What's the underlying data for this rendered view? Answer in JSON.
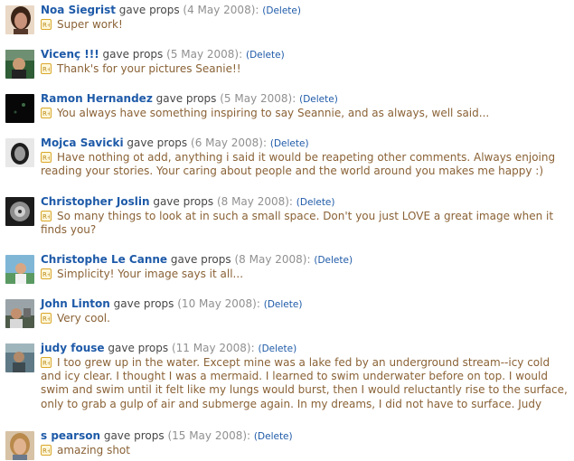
{
  "props": [
    {
      "user": "Noa Siegrist",
      "action": "gave props",
      "date": "(4 May 2008):",
      "delete_label": "(Delete)",
      "message": "Super work!"
    },
    {
      "user": "Vicenç !!!",
      "action": "gave props",
      "date": "(5 May 2008):",
      "delete_label": "(Delete)",
      "message": "Thank's for your pictures Seanie!!"
    },
    {
      "user": "Ramon Hernandez",
      "action": "gave props",
      "date": "(5 May 2008):",
      "delete_label": "(Delete)",
      "message": "You always have something inspiring to say Seannie, and as always, well said..."
    },
    {
      "user": "Mojca Savicki",
      "action": "gave props",
      "date": "(6 May 2008):",
      "delete_label": "(Delete)",
      "message": "Have nothing ot add, anything i said it would be reapeting other comments. Always enjoing reading your stories. Your caring about people and the world around you makes me happy :)"
    },
    {
      "user": "Christopher Joslin",
      "action": "gave props",
      "date": "(8 May 2008):",
      "delete_label": "(Delete)",
      "message": "So many things to look at in such a small space. Don't you just LOVE a great image when it finds you?"
    },
    {
      "user": "Christophe Le Canne",
      "action": "gave props",
      "date": "(8 May 2008):",
      "delete_label": "(Delete)",
      "message": "Simplicity! Your image says it all..."
    },
    {
      "user": "John Linton",
      "action": "gave props",
      "date": "(10 May 2008):",
      "delete_label": "(Delete)",
      "message": "Very cool."
    },
    {
      "user": "judy fouse",
      "action": "gave props",
      "date": "(11 May 2008):",
      "delete_label": "(Delete)",
      "message": "I too grew up in the water. Except mine was a lake fed by an underground stream--icy cold and icy clear. I thought I was a mermaid. I learned to swim underwater before on top. I would swim and swim until it felt like my lungs would burst, then I would reluctantly rise to the surface, only to grab a gulp of air and submerge again. In my dreams, I did not have to surface. Judy"
    },
    {
      "user": "s pearson",
      "action": "gave props",
      "date": "(15 May 2008):",
      "delete_label": "(Delete)",
      "message": "amazing shot"
    }
  ],
  "colors": {
    "user_link": "#1e5aa8",
    "message": "#8a6236",
    "date": "#909090",
    "icon_border": "#d9a72b"
  },
  "icons": {
    "message": "props-icon"
  }
}
